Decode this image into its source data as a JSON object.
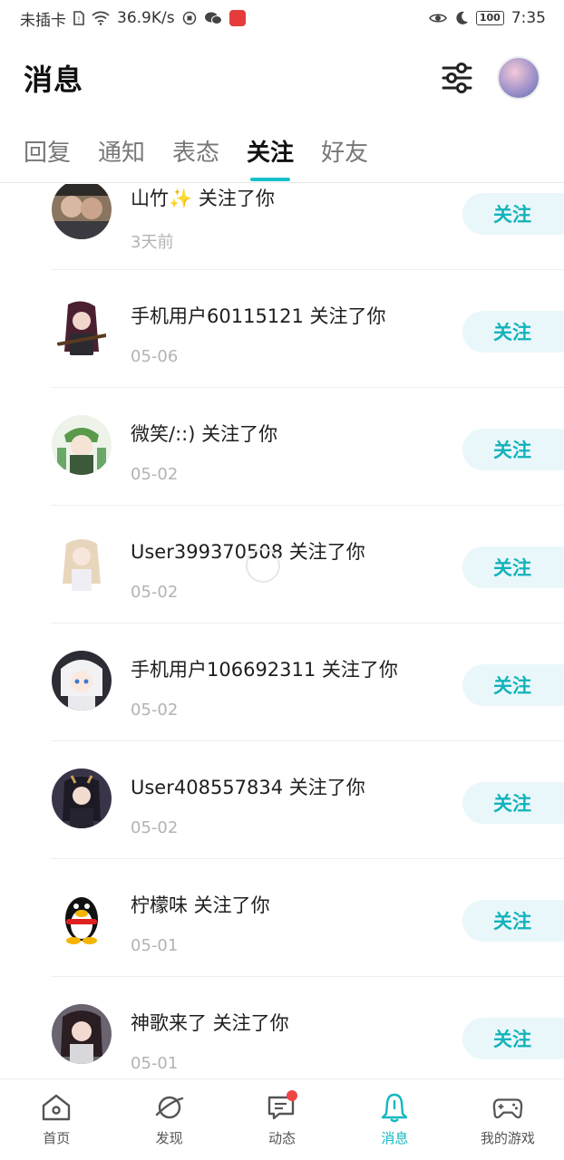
{
  "status_bar": {
    "carrier": "未插卡",
    "speed": "36.9K/s",
    "battery": "100",
    "time": "7:35"
  },
  "header": {
    "title": "消息"
  },
  "tabs": [
    {
      "label": "回复"
    },
    {
      "label": "通知"
    },
    {
      "label": "表态"
    },
    {
      "label": "关注"
    },
    {
      "label": "好友"
    }
  ],
  "active_tab": "关注",
  "follow_label": "关注",
  "notifications": [
    {
      "text": "山竹✨ 关注了你",
      "time": "3天前"
    },
    {
      "text": "手机用户60115121 关注了你",
      "time": "05-06"
    },
    {
      "text": "微笑/::) 关注了你",
      "time": "05-02"
    },
    {
      "text": "User399370508 关注了你",
      "time": "05-02"
    },
    {
      "text": "手机用户106692311 关注了你",
      "time": "05-02"
    },
    {
      "text": "User408557834 关注了你",
      "time": "05-02"
    },
    {
      "text": "柠檬味 关注了你",
      "time": "05-01"
    },
    {
      "text": "神歌来了 关注了你",
      "time": "05-01"
    }
  ],
  "colors": {
    "accent": "#14c1c8",
    "follow_bg": "#eaf7fa",
    "follow_text": "#12b3bb",
    "badge": "#ef4545"
  },
  "bottom_nav": [
    {
      "label": "首页",
      "icon": "home-icon"
    },
    {
      "label": "发现",
      "icon": "planet-icon"
    },
    {
      "label": "动态",
      "icon": "chat-icon"
    },
    {
      "label": "消息",
      "icon": "bell-icon"
    },
    {
      "label": "我的游戏",
      "icon": "gamepad-icon"
    }
  ]
}
